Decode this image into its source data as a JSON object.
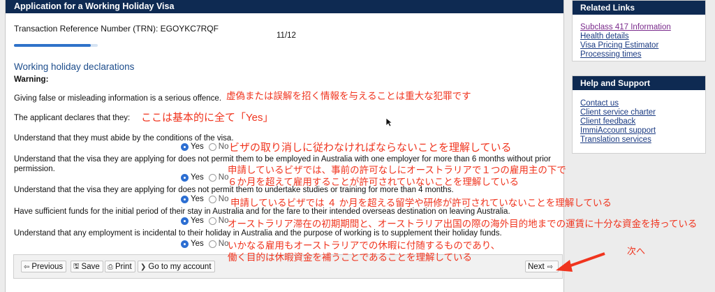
{
  "form": {
    "title": "Application for a Working Holiday Visa",
    "trn": "Transaction Reference Number (TRN): EGOYKC7RQF",
    "page_count": "11/12",
    "progress": 0.92,
    "section_title": "Working holiday declarations",
    "warning": "Warning:",
    "giving_false": "Giving false or misleading information is a serious offence.",
    "applicant_declares": "The applicant declares that they:",
    "q1": "Understand that they must abide by the conditions of the visa.",
    "q2a": "Understand that the visa they are applying for does not permit them to be employed in Australia with one employer for more than 6 months without prior",
    "q2b": "permission.",
    "q3": "Understand that the visa they are applying for does not permit them to undertake studies or training for more than 4 months.",
    "q4": "Have sufficient funds for the initial period of their stay in Australia and for the fare to their intended overseas destination on leaving Australia.",
    "q5": "Understand that any employment is incidental to their holiday in Australia and the purpose of working is to supplement their holiday funds.",
    "yes": "Yes",
    "no": "No"
  },
  "buttons": {
    "previous": "Previous",
    "save": "Save",
    "print": "Print",
    "go_account": "Go to my account",
    "next": "Next"
  },
  "annotations": {
    "a1": "虚偽または誤解を招く情報を与えることは重大な犯罪です",
    "a2": "ここは基本的に全て「Yes」",
    "a3": "ビザの取り消しに従わなければならないことを理解している",
    "a4_1": "申請しているビザでは、事前の許可なしにオーストラリアで１つの雇用主の下で",
    "a4_2": "６か月を超えて雇用することが許可されていないことを理解している",
    "a5": "申請しているビザでは ４ か月を超える留学や研修が許可されていないことを理解している",
    "a6": "オーストラリア滞在の初期期間と、オーストラリア出国の際の海外目的地までの運賃に十分な資金を持っている",
    "a7_1": "いかなる雇用もオーストラリアでの休暇に付随するものであり、",
    "a7_2": "働く目的は休暇資金を補うことであることを理解している",
    "next_note": "次へ",
    "color": "#f0341e"
  },
  "related_links": {
    "title": "Related Links",
    "items": [
      "Subclass 417 Information",
      "Health details",
      "Visa Pricing Estimator",
      "Processing times"
    ]
  },
  "help_support": {
    "title": "Help and Support",
    "items": [
      "Contact us",
      "Client service charter",
      "Client feedback",
      "ImmiAccount support",
      "Translation services"
    ]
  }
}
